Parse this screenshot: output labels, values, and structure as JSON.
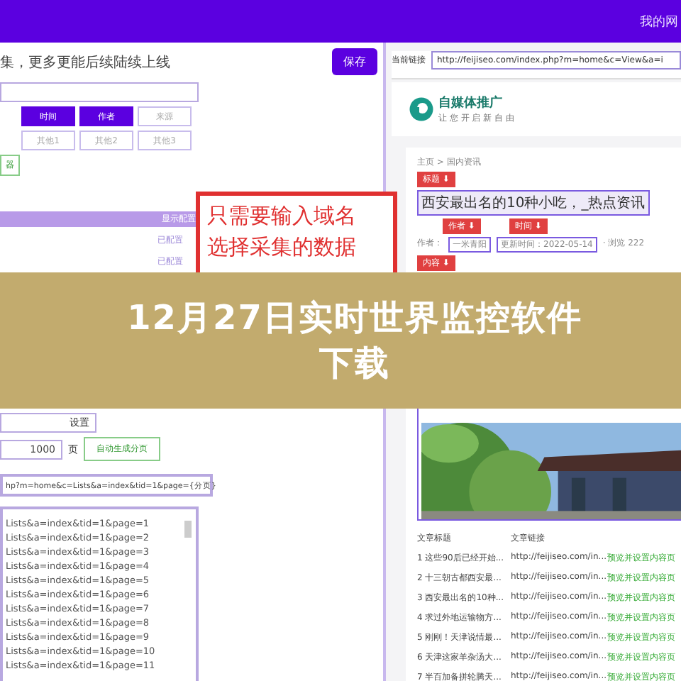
{
  "top_bar": {
    "right_text": "我的网"
  },
  "left": {
    "heading": "集，更多更能后续陆续上线",
    "save_button": "保存",
    "tags": [
      {
        "label": "时间",
        "selected": true
      },
      {
        "label": "作者",
        "selected": true
      },
      {
        "label": "来源",
        "selected": false
      },
      {
        "label": "其他1",
        "selected": false
      },
      {
        "label": "其他2",
        "selected": false
      },
      {
        "label": "其他3",
        "selected": false
      }
    ],
    "green_tag": "器",
    "section_bar": "显示配置",
    "configured": [
      "已配置",
      "已配置"
    ],
    "settings_button": "设置",
    "pages_value": "1000",
    "pages_unit": "页",
    "generate_button": "自动生成分页",
    "url_field": "hp?m=home&c=Lists&a=index&tid=1&page={分页}",
    "url_list": [
      "Lists&a=index&tid=1&page=1",
      "Lists&a=index&tid=1&page=2",
      "Lists&a=index&tid=1&page=3",
      "Lists&a=index&tid=1&page=4",
      "Lists&a=index&tid=1&page=5",
      "Lists&a=index&tid=1&page=6",
      "Lists&a=index&tid=1&page=7",
      "Lists&a=index&tid=1&page=8",
      "Lists&a=index&tid=1&page=9",
      "Lists&a=index&tid=1&page=10",
      "Lists&a=index&tid=1&page=11"
    ]
  },
  "callout": {
    "lines": [
      "只需要输入域名",
      "选择采集的数据"
    ]
  },
  "banner": {
    "line_1": "12月27日实时世界监控软件",
    "line_2": "下载"
  },
  "right": {
    "url_label": "当前链接",
    "url_value": "http://feijiseo.com/index.php?m=home&c=View&a=i",
    "logo": "自媒体推广",
    "logo_tagline": "让 您 开 启 新 自 由",
    "breadcrumb": "主页 > 国内资讯",
    "title_tag": "标题 ⬇",
    "article_title": "西安最出名的10种小吃，_热点资讯",
    "author_tag": "作者 ⬇",
    "time_tag": "时间 ⬇",
    "author_label": "作者：",
    "author": "一米青阳",
    "date": "更新时间：2022-05-14",
    "views": "· 浏览 222",
    "content_tag": "内容 ⬇",
    "table": {
      "columns": [
        "文章标题",
        "文章链接"
      ],
      "rows": [
        {
          "title": "1 这些90后已经开始...",
          "link": "http://feijiseo.com/in...",
          "action": "预览并设置内容页"
        },
        {
          "title": "2 十三朝古都西安最...",
          "link": "http://feijiseo.com/in...",
          "action": "预览并设置内容页"
        },
        {
          "title": "3 西安最出名的10种...",
          "link": "http://feijiseo.com/in...",
          "action": "预览并设置内容页"
        },
        {
          "title": "4 求过外地运输物方...",
          "link": "http://feijiseo.com/in...",
          "action": "预览并设置内容页"
        },
        {
          "title": "5 刚刚！天津说情最...",
          "link": "http://feijiseo.com/in...",
          "action": "预览并设置内容页"
        },
        {
          "title": "6 天津这家羊杂汤大...",
          "link": "http://feijiseo.com/in...",
          "action": "预览并设置内容页"
        },
        {
          "title": "7 半百加备拼轮腾天...",
          "link": "http://feijiseo.com/in...",
          "action": "预览并设置内容页"
        }
      ]
    }
  }
}
